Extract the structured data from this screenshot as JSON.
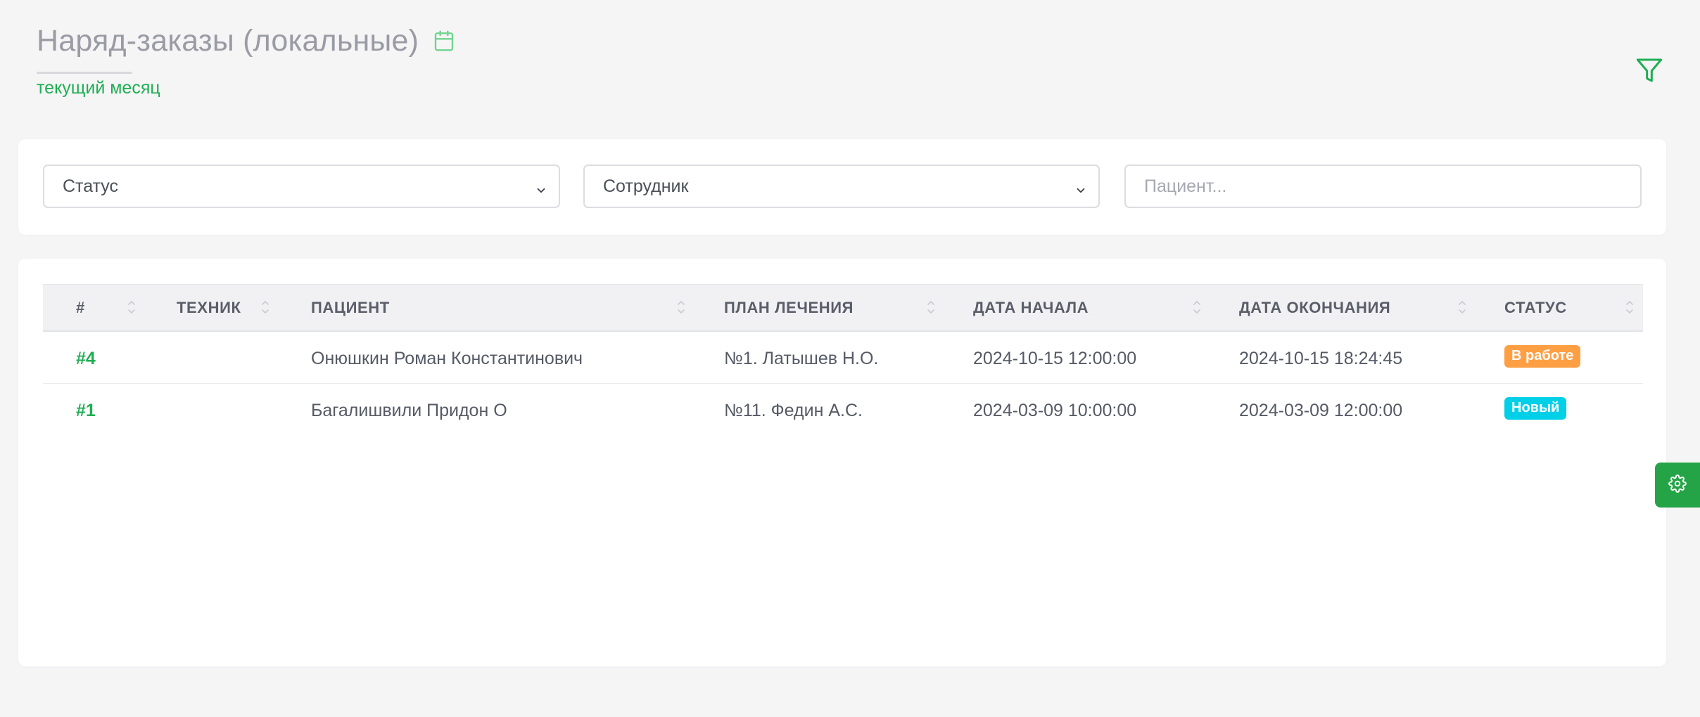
{
  "header": {
    "title": "Наряд-заказы (локальные)",
    "subtitle": "текущий месяц"
  },
  "icons": {
    "calendar": "calendar-icon",
    "filter": "filter-icon",
    "settings": "gear-icon",
    "chevron": "chevron-down-icon",
    "sort": "sort-icon"
  },
  "colors": {
    "accent": "#1fae52",
    "status_in_progress": "#ff9f43",
    "status_new": "#00cfe8",
    "settings_button": "#25a447"
  },
  "filters": {
    "status_label": "Статус",
    "employee_label": "Сотрудник",
    "patient_placeholder": "Пациент..."
  },
  "table": {
    "headers": {
      "id": "#",
      "technician": "ТЕХНИК",
      "patient": "ПАЦИЕНТ",
      "plan": "ПЛАН ЛЕЧЕНИЯ",
      "start": "ДАТА НАЧАЛА",
      "end": "ДАТА ОКОНЧАНИЯ",
      "status": "СТАТУС"
    },
    "rows": [
      {
        "id": "#4",
        "technician": "",
        "patient": "Онюшкин Роман Константинович",
        "plan": "№1. Латышев Н.О.",
        "start": "2024-10-15 12:00:00",
        "end": "2024-10-15 18:24:45",
        "status": "В работе"
      },
      {
        "id": "#1",
        "technician": "",
        "patient": "Багалишвили Придон О",
        "plan": "№11. Федин А.С.",
        "start": "2024-03-09 10:00:00",
        "end": "2024-03-09 12:00:00",
        "status": "Новый"
      }
    ]
  }
}
